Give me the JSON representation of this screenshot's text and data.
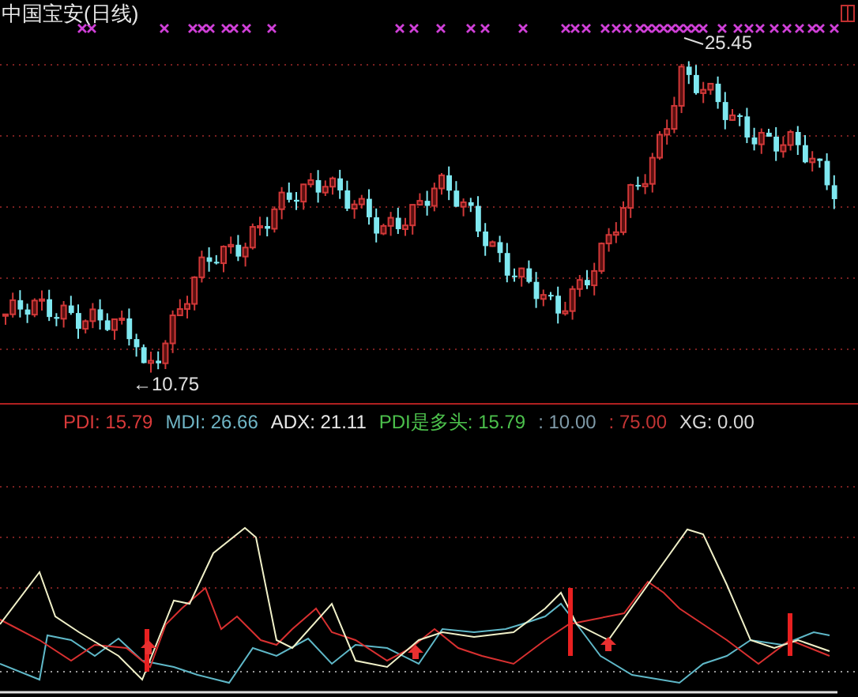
{
  "window": {
    "title": "中国宝安(日线)"
  },
  "price_chart": {
    "high_label": "25.45",
    "low_label": "←10.75"
  },
  "indicator": {
    "readouts": [
      {
        "text": "PDI: 15.79",
        "color": "#d83a3a"
      },
      {
        "text": "MDI: 26.66",
        "color": "#6fb4c4"
      },
      {
        "text": "ADX: 21.11",
        "color": "#e8e8e8"
      },
      {
        "text": "PDI是多头: 15.79",
        "color": "#4cc04c"
      },
      {
        "text": ": 10.00",
        "color": "#7f9aa8"
      },
      {
        "text": ": 75.00",
        "color": "#c23434"
      },
      {
        "text": "XG: 0.00",
        "color": "#d8d8d8"
      }
    ]
  }
}
